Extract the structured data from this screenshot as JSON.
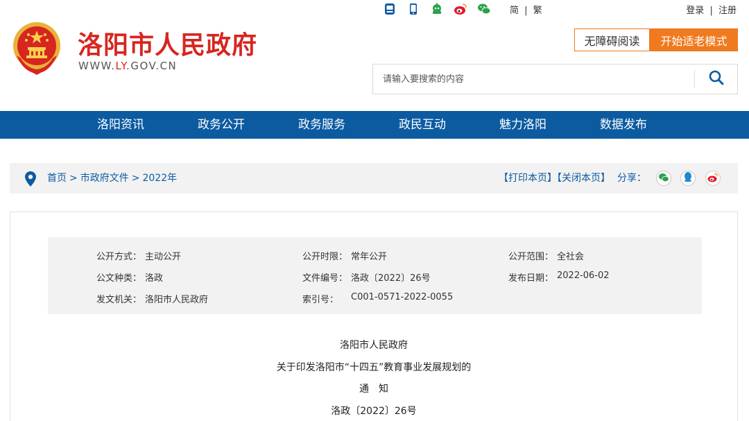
{
  "header": {
    "site_name": "洛阳市人民政府",
    "url_prefix": "WWW.",
    "url_ly": "LY",
    "url_suffix": ".GOV.CN",
    "lang_simplified": "简",
    "lang_sep": "|",
    "lang_traditional": "繁",
    "login": "登录",
    "auth_sep": "|",
    "register": "注册",
    "accessible_btn": "无障碍阅读",
    "elder_mode_btn": "开始适老模式",
    "search_placeholder": "请输入要搜索的内容",
    "top_icons": [
      "app-icon",
      "mobile-icon",
      "robot-icon",
      "weibo-icon",
      "wechat-icon"
    ]
  },
  "nav": {
    "items": [
      "洛阳资讯",
      "政务公开",
      "政务服务",
      "政民互动",
      "魅力洛阳",
      "数据发布"
    ]
  },
  "breadcrumb": {
    "home": "首页",
    "level1": "市政府文件",
    "level2": "2022年",
    "sep": ">",
    "print": "【打印本页】",
    "close": "【关闭本页】",
    "share": "分享：",
    "share_icons": [
      "wechat-icon",
      "qq-icon",
      "weibo-icon"
    ]
  },
  "meta": {
    "disclosure_method_label": "公开方式：",
    "disclosure_method": "主动公开",
    "disclosure_period_label": "公开时限：",
    "disclosure_period": "常年公开",
    "disclosure_scope_label": "公开范围：",
    "disclosure_scope": "全社会",
    "doc_type_label": "公文种类：",
    "doc_type": "洛政",
    "doc_number_label": "文件编号：",
    "doc_number": "洛政〔2022〕26号",
    "publish_date_label": "发布日期：",
    "publish_date": "2022-06-02",
    "issuer_label": "发文机关：",
    "issuer": "洛阳市人民政府",
    "index_label": "索引号：",
    "index": "C001-0571-2022-0055"
  },
  "document": {
    "issuer_line": "洛阳市人民政府",
    "title_line": "关于印发洛阳市“十四五”教育事业发展规划的",
    "notice_line": "通　知",
    "number_line": "洛政〔2022〕26号"
  },
  "colors": {
    "brand_red": "#d7251f",
    "nav_blue": "#0c5ba1",
    "accent_orange": "#f07a1f"
  }
}
